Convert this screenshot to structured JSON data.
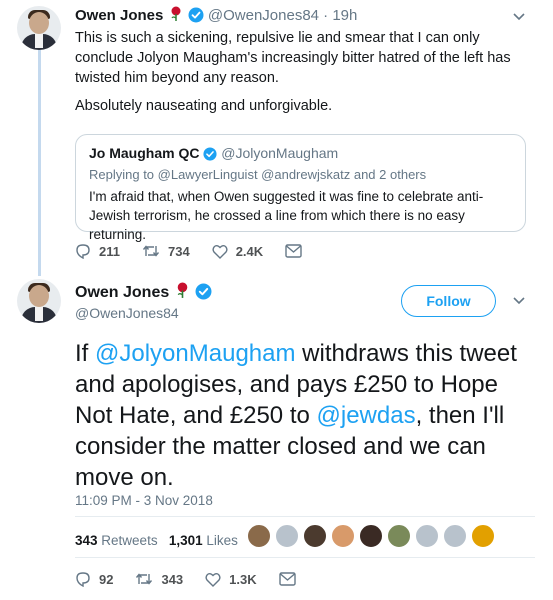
{
  "tweet1": {
    "name": "Owen Jones",
    "handle": "@OwenJones84",
    "time": "· 19h",
    "text": "This is such a sickening, repulsive lie and smear that I can only conclude Jolyon Maugham's increasingly bitter hatred of the left has twisted him beyond any reason.",
    "text2": "Absolutely nauseating and unforgivable.",
    "quote": {
      "name": "Jo Maugham QC",
      "handle": "@JolyonMaugham",
      "reply": "Replying to @LawyerLinguist @andrewjskatz and 2 others",
      "text": "I'm afraid that, when Owen suggested it was fine to celebrate anti-Jewish terrorism, he crossed a line from which there is no easy returning."
    },
    "actions": {
      "replies": "211",
      "retweets": "734",
      "likes": "2.4K"
    }
  },
  "tweet2": {
    "name": "Owen Jones",
    "handle": "@OwenJones84",
    "follow_label": "Follow",
    "text_parts": {
      "p1": "If ",
      "mention1": "@JolyonMaugham",
      "p2": " withdraws this tweet and apologises, and pays £250 to Hope Not Hate, and £250 to ",
      "mention2": "@jewdas",
      "p3": ", then I'll consider the matter closed and we can move on."
    },
    "timestamp": "11:09 PM - 3 Nov 2018",
    "stats": {
      "retweets_count": "343",
      "retweets_label": "Retweets",
      "likes_count": "1,301",
      "likes_label": "Likes"
    },
    "actions": {
      "replies": "92",
      "retweets": "343",
      "likes": "1.3K"
    }
  },
  "colors": {
    "accent": "#1da1f2",
    "muted": "#657786",
    "text": "#14171a",
    "rose": "#c8102e"
  },
  "icons": [
    "rose-icon",
    "verified-icon",
    "chevron-down-icon",
    "reply-icon",
    "retweet-icon",
    "like-icon",
    "dm-icon"
  ]
}
